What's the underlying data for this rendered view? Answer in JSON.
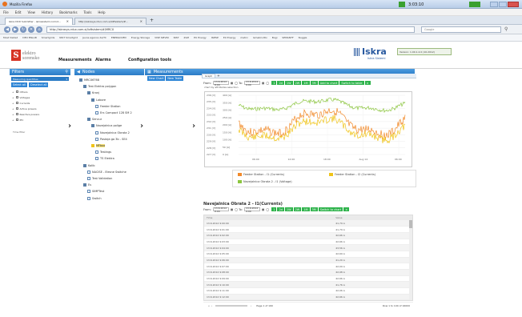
{
  "browser": {
    "window_title": "Mozilla Firefox",
    "clock": "3:03:10",
    "menu": [
      "File",
      "Edit",
      "View",
      "History",
      "Bookmarks",
      "Tools",
      "Help"
    ],
    "tabs": [
      {
        "label": "Iskra DCD Submitter - iskrasistemi.com/d...",
        "active": true
      },
      {
        "label": "http://iskrasys.rdux.com.si/loftsistem/#...",
        "active": false
      }
    ],
    "url": "http://iskrasys.rdux.com.si/loftsistem/#/MRCX",
    "search_placeholder": "Google",
    "bookmarks": [
      "Most Visited",
      "DEO ENLAB",
      "Smartgrids",
      "NIST Smartgrid",
      "Jeune agence da/TC",
      "ENERGOVED",
      "Energy Storage",
      "VISE SIEVNI",
      "NIST",
      "ZGH",
      "EU Energy",
      "ISMSP",
      "EU Energy",
      "metric",
      "Ismabil.2Dv",
      "Bogi",
      "SEMANTF",
      "Nuggle"
    ]
  },
  "app": {
    "brand_line1": "elektro",
    "brand_line2": "sorensko",
    "menu": [
      "Measurements",
      "Alarms",
      "Configuration tools"
    ],
    "iskra_logo": "Iskra",
    "iskra_sub": "Iskra Sistemi",
    "version": "Version: 1.00.1.2.0 (10.2012)"
  },
  "filters": {
    "title": "Filters",
    "dropdown": "Measuring quantities",
    "select_all": "Select all",
    "deselect_all": "Deselect all",
    "items": [
      "Others",
      "Voltages",
      "Currents",
      "Active powers",
      "Reactive powers",
      "IEC"
    ],
    "bottom_label": "Time filter"
  },
  "nodes": {
    "title": "Nodes",
    "items": [
      {
        "label": "MRCX6T68",
        "depth": 0,
        "icon": "node"
      },
      {
        "label": "Test Elektro polygon",
        "depth": 1,
        "icon": "node"
      },
      {
        "label": "Kranj",
        "depth": 2,
        "icon": "node"
      },
      {
        "label": "Labore",
        "depth": 3,
        "icon": "node"
      },
      {
        "label": "Feeder Station",
        "depth": 4,
        "icon": "doc"
      },
      {
        "label": "Ers Compact 128 SM 2",
        "depth": 4,
        "icon": "doc"
      },
      {
        "label": "Sencur",
        "depth": 2,
        "icon": "node"
      },
      {
        "label": "Navejalnica polige",
        "depth": 3,
        "icon": "node"
      },
      {
        "label": "Navejalnica Obrata 2",
        "depth": 4,
        "icon": "doc"
      },
      {
        "label": "Postaja ga 3b - SE4",
        "depth": 4,
        "icon": "doc"
      },
      {
        "label": "MFbox",
        "depth": 3,
        "icon": "hilite"
      },
      {
        "label": "Testings",
        "depth": 4,
        "icon": "doc"
      },
      {
        "label": "TS Elektra",
        "depth": 4,
        "icon": "doc"
      },
      {
        "label": "Kolib",
        "depth": 1,
        "icon": "node"
      },
      {
        "label": "NACISE - Elesne Switche",
        "depth": 2,
        "icon": "doc"
      },
      {
        "label": "Test Validation",
        "depth": 2,
        "icon": "doc"
      },
      {
        "label": "Es",
        "depth": 1,
        "icon": "node"
      },
      {
        "label": "SIMPTest",
        "depth": 2,
        "icon": "doc"
      },
      {
        "label": "Switch",
        "depth": 2,
        "icon": "doc"
      }
    ]
  },
  "measurements": {
    "title": "Measurements",
    "new_chart": "New Chart",
    "new_table": "New Table",
    "tab_label": "Graph",
    "from_label": "From:",
    "from_value": "13.6.2012 8:00",
    "to_label": "To:",
    "to_value": "13.6.2012 9:00",
    "range_buttons": [
      "1",
      "2d",
      "1W",
      "2W",
      "1M",
      "3M"
    ],
    "add_to_chart": "Add to chart",
    "switch_to_table": "Switch to table",
    "note": "chart by attributes selection"
  },
  "chart_data": {
    "type": "line",
    "y_left_ticks": [
      "236 [V]",
      "235 [V]",
      "234 [V]",
      "233 [V]",
      "232 [V]",
      "231 [V]",
      "230 [V]",
      "229 [V]",
      "228 [V]",
      "227 [V]"
    ],
    "y_right_ticks": [
      "400 [A]",
      "350 [A]",
      "300 [A]",
      "250 [A]",
      "200 [A]",
      "150 [A]",
      "100 [A]",
      "50 [A]",
      "0 [A]"
    ],
    "x_ticks": [
      "06:00",
      "12:00",
      "18:00",
      "Aug 14",
      "06:00"
    ],
    "series": [
      {
        "name": "Feeder Station - I1 (Currents)",
        "color": "#f28a2a"
      },
      {
        "name": "Feeder Station - I2 (Currents)",
        "color": "#f0c419"
      },
      {
        "name": "Navejalnica Obrata 2 - I1 (Voltage)",
        "color": "#8cc63f"
      }
    ]
  },
  "table_panel": {
    "title": "Navejalnica Obrata 2 - I1(Currents)",
    "from_label": "From:",
    "from_value": "13.6.2012 8:00",
    "to_label": "To:",
    "to_value": "13.6.2012 9:00",
    "switch_to_chart": "Switch to chart",
    "col_time": "Time",
    "col_value": "Value",
    "rows": [
      [
        "13.6.2012 9:00:00",
        "41,79 A"
      ],
      [
        "13.6.2012 9:01:00",
        "41,79 A"
      ],
      [
        "13.6.2012 9:02:00",
        "42,66 A"
      ],
      [
        "13.6.2012 9:03:00",
        "42,66 A"
      ],
      [
        "13.6.2012 9:04:00",
        "43,56 A"
      ],
      [
        "13.6.2012 9:05:00",
        "42,69 A"
      ],
      [
        "13.6.2012 9:06:00",
        "41,20 A"
      ],
      [
        "13.6.2012 9:07:00",
        "42,09 A"
      ],
      [
        "13.6.2012 9:08:00",
        "42,98 A"
      ],
      [
        "13.6.2012 9:09:00",
        "42,66 A"
      ],
      [
        "13.6.2012 9:10:00",
        "41,76 A"
      ],
      [
        "13.6.2012 9:11:00",
        "42,06 A"
      ],
      [
        "13.6.2012 9:12:00",
        "42,66 A"
      ],
      [
        "13.6.2012 9:13:00",
        "41,79 A"
      ]
    ],
    "page_label": "Page 1 of 160",
    "showing": "Row 1 to 100 of 16000"
  }
}
